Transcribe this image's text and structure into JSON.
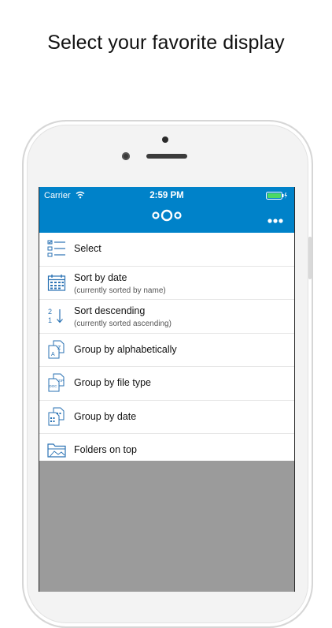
{
  "headline": "Select your favorite display",
  "status_bar": {
    "carrier": "Carrier",
    "time": "2:59 PM"
  },
  "app": {
    "logo_icon": "nextcloud-logo-icon",
    "more_icon": "more-horizontal-icon",
    "accent_color": "#0082c9"
  },
  "menu": {
    "items": [
      {
        "label": "Select",
        "sub": "",
        "icon": "checklist-icon"
      },
      {
        "label": "Sort by date",
        "sub": "(currently sorted by name)",
        "icon": "calendar-icon"
      },
      {
        "label": "Sort descending",
        "sub": "(currently sorted ascending)",
        "icon": "sort-descending-icon"
      },
      {
        "label": "Group by alphabetically",
        "sub": "",
        "icon": "alphabet-files-icon"
      },
      {
        "label": "Group by file type",
        "sub": "",
        "icon": "file-type-icon"
      },
      {
        "label": "Group by date",
        "sub": "",
        "icon": "calendar-files-icon"
      },
      {
        "label": "Folders on top",
        "sub": "",
        "icon": "folder-icon"
      }
    ]
  }
}
